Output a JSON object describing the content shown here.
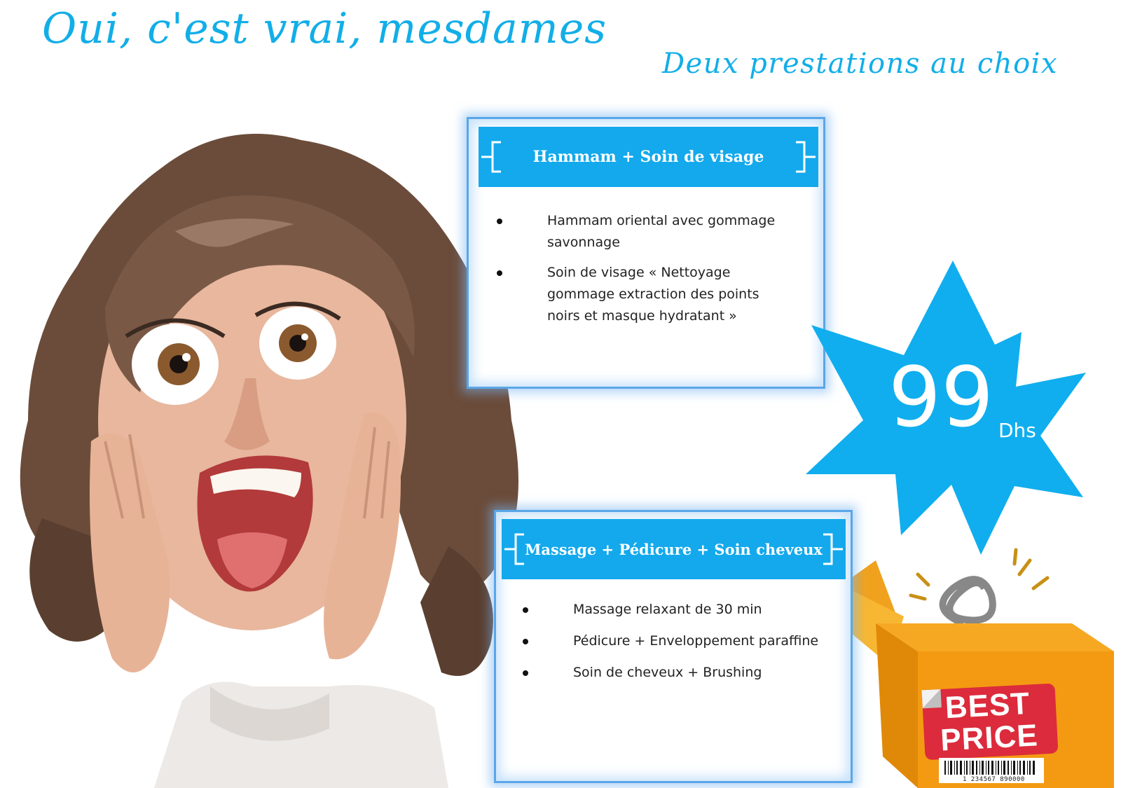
{
  "headline": "Oui, c'est vrai, mesdames",
  "subheadline": "Deux prestations au choix",
  "offers": [
    {
      "title": "Hammam + Soin de visage",
      "items": [
        "Hammam oriental avec gommage savonnage",
        "Soin de visage « Nettoyage gommage extraction des points noirs et masque hydratant »"
      ]
    },
    {
      "title": "Massage + Pédicure + Soin cheveux",
      "items": [
        "Massage relaxant de 30 min",
        "Pédicure + Enveloppement paraffine",
        "Soin de cheveux + Brushing"
      ]
    }
  ],
  "price": {
    "value": "99",
    "unit": "Dhs"
  },
  "badge": {
    "line1": "BEST",
    "line2": "PRICE",
    "barcode_number": "1 234567 890000"
  },
  "colors": {
    "accent": "#13a9ec",
    "card_border": "#5aa6e8",
    "badge_red": "#dc2b3c",
    "box_orange": "#f5a623"
  }
}
